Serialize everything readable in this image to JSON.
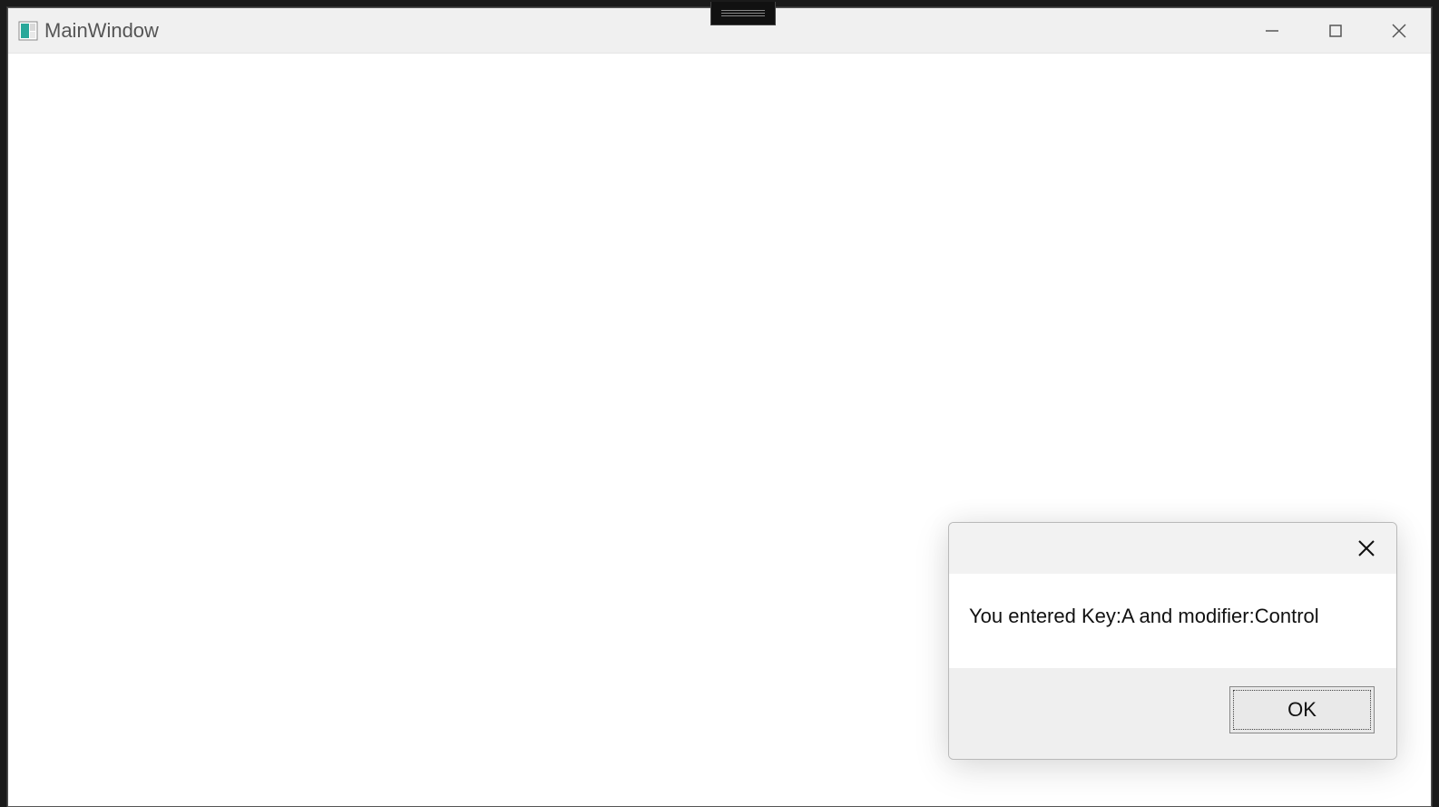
{
  "window": {
    "title": "MainWindow"
  },
  "dialog": {
    "message": "You entered Key:A and modifier:Control",
    "ok_label": "OK"
  }
}
